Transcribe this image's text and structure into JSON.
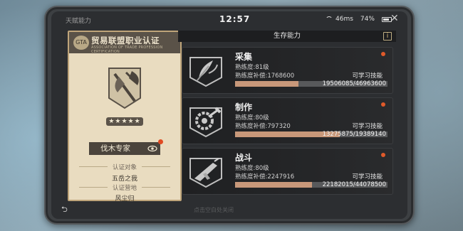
{
  "status": {
    "section_title": "天赋能力",
    "time": "12:57",
    "ping": "46ms",
    "battery": "74%",
    "close_glyph": "✕"
  },
  "certificate": {
    "header_title": "贸易联盟职业认证",
    "header_sub": "ASSOCIATION OF TRADE PROFESSION CERTIFICATION",
    "logo_text": "GTA",
    "stars": "★★★★★",
    "rank_name": "伐木专家",
    "target_label": "认证对象",
    "target_value": "五岳之我",
    "camp_label": "认证营地",
    "camp_value": "风尘归"
  },
  "panel": {
    "title": "生存能力",
    "info_glyph": "i"
  },
  "skills": [
    {
      "name": "采集",
      "level": "熟练度:81级",
      "compensation": "熟练度补偿:1768600",
      "learn": "可学习技能",
      "progress": "19506085/46963600",
      "fill": 0.415
    },
    {
      "name": "制作",
      "level": "熟练度:80级",
      "compensation": "熟练度补偿:797320",
      "learn": "可学习技能",
      "progress": "13275875/19389140",
      "fill": 0.685
    },
    {
      "name": "战斗",
      "level": "熟练度:80级",
      "compensation": "熟练度补偿:2247916",
      "learn": "可学习技能",
      "progress": "22182015/44078500",
      "fill": 0.503
    }
  ],
  "footer": {
    "back_glyph": "⮌",
    "hint": "点击空白处关闭"
  },
  "colors": {
    "accent_red": "#e05a2a",
    "bar_fill": "#c8987a",
    "card_bg": "#e9dcc0"
  }
}
